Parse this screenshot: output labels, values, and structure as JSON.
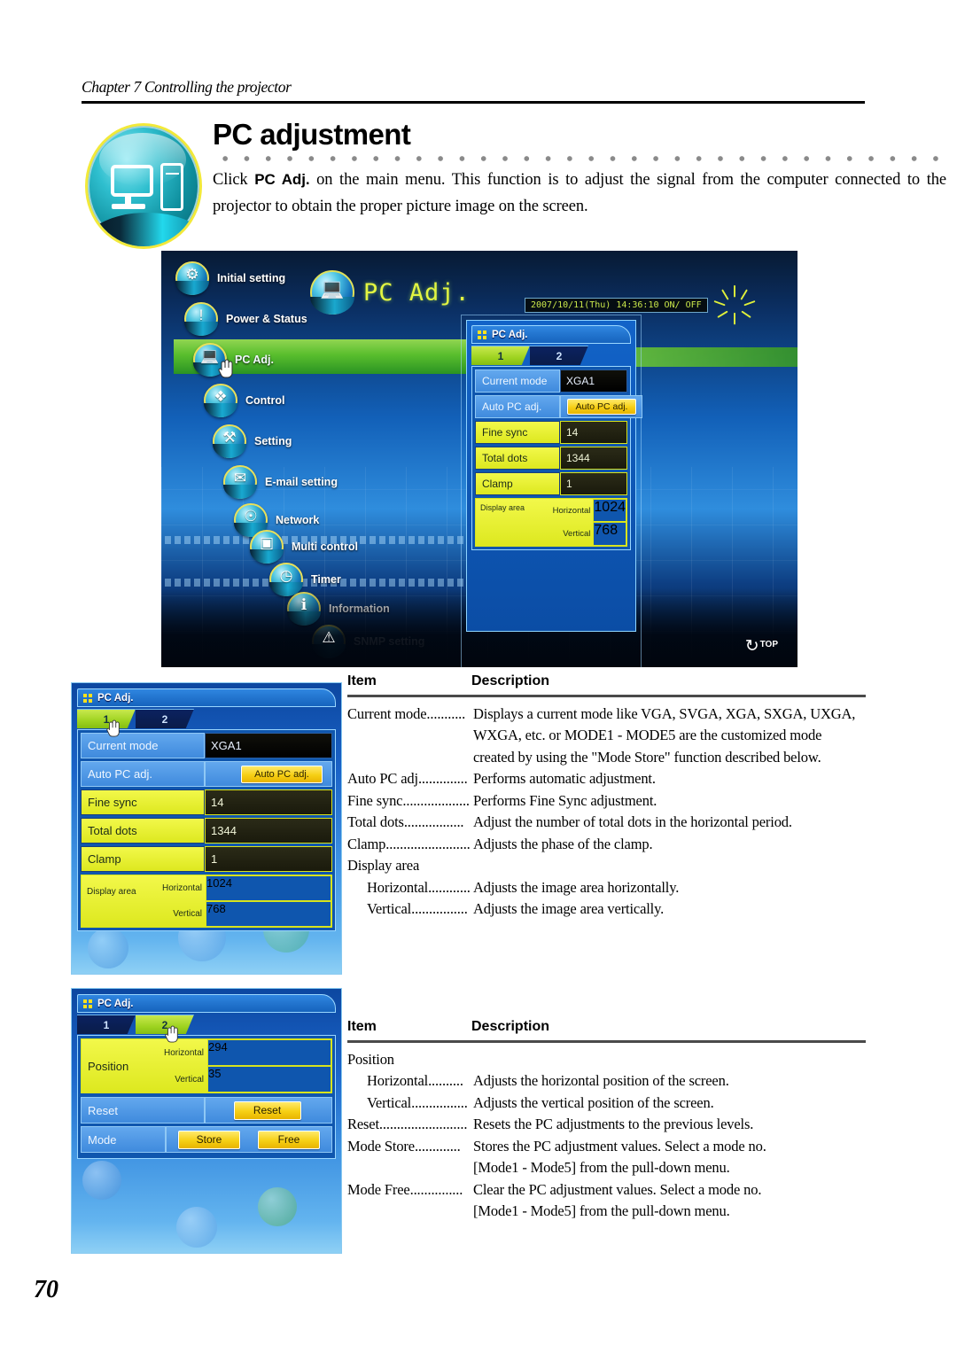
{
  "header": {
    "chapter": "Chapter 7 Controlling the projector"
  },
  "title": {
    "heading": "PC adjustment",
    "intro_prefix": "Click ",
    "intro_bold": "PC Adj.",
    "intro_rest": " on the main menu. This function is to adjust the signal from the computer connected to the projector to obtain the proper picture image on the screen."
  },
  "screenshot": {
    "banner_label": "PC Adj.",
    "datetime": "2007/10/11(Thu)  14:36:10  ON/ OFF",
    "top_button": "TOP",
    "menu_items": [
      {
        "label": "Initial setting",
        "icon": "gear-projector-icon"
      },
      {
        "label": "Power & Status",
        "icon": "power-status-icon"
      },
      {
        "label": "PC Adj.",
        "icon": "monitor-tower-icon"
      },
      {
        "label": "Control",
        "icon": "dpad-icon"
      },
      {
        "label": "Setting",
        "icon": "tools-icon"
      },
      {
        "label": "E-mail setting",
        "icon": "envelope-icon"
      },
      {
        "label": "Network",
        "icon": "network-icon"
      },
      {
        "label": "Multi control",
        "icon": "multi-control-icon"
      },
      {
        "label": "Timer",
        "icon": "clock-icon"
      },
      {
        "label": "Information",
        "icon": "info-icon"
      },
      {
        "label": "SNMP setting",
        "icon": "snmp-icon"
      }
    ]
  },
  "dialog_tab1": {
    "title": "PC Adj.",
    "tabs": [
      {
        "label": "1",
        "active": true
      },
      {
        "label": "2",
        "active": false
      }
    ],
    "rows": [
      {
        "label": "Current mode",
        "value": "XGA1",
        "style": "blue-plain"
      },
      {
        "label": "Auto PC adj.",
        "button": "Auto PC adj.",
        "style": "blue-button"
      },
      {
        "label": "Fine sync",
        "value": "14",
        "style": "yellow"
      },
      {
        "label": "Total dots",
        "value": "1344",
        "style": "yellow"
      },
      {
        "label": "Clamp",
        "value": "1",
        "style": "yellow"
      }
    ],
    "display_area": {
      "group_label": "Display area",
      "horizontal_label": "Horizontal",
      "horizontal_value": "1024",
      "vertical_label": "Vertical",
      "vertical_value": "768"
    }
  },
  "dialog_tab2": {
    "title": "PC Adj.",
    "tabs": [
      {
        "label": "1",
        "active": false
      },
      {
        "label": "2",
        "active": true
      }
    ],
    "position": {
      "group_label": "Position",
      "horizontal_label": "Horizontal",
      "horizontal_value": "294",
      "vertical_label": "Vertical",
      "vertical_value": "35"
    },
    "reset_row": {
      "label": "Reset",
      "button": "Reset"
    },
    "mode_row": {
      "label": "Mode",
      "button_store": "Store",
      "button_free": "Free"
    }
  },
  "table1": {
    "head_item": "Item",
    "head_description": "Description",
    "rows": [
      {
        "item": "Current mode",
        "dots": "...........",
        "desc": "Displays a current mode like VGA, SVGA, XGA, SXGA, UXGA,",
        "indent": false
      },
      {
        "item": "",
        "dots": "",
        "desc": "WXGA, etc. or MODE1 - MODE5 are the customized mode",
        "cont": true
      },
      {
        "item": "",
        "dots": "",
        "desc": "created by using the \"Mode Store\" function described below.",
        "cont": true
      },
      {
        "item": "Auto PC adj.",
        "dots": ".............",
        "desc": "Performs automatic adjustment.",
        "indent": false
      },
      {
        "item": "Fine sync.",
        "dots": "..................",
        "desc": "Performs Fine Sync adjustment.",
        "indent": false
      },
      {
        "item": "Total dots",
        "dots": ".................",
        "desc": "Adjust the number of total dots in the horizontal period.",
        "indent": false
      },
      {
        "item": "Clamp",
        "dots": "........................",
        "desc": "Adjusts the phase of the clamp.",
        "indent": false
      },
      {
        "item": "Display area",
        "dots": "",
        "desc": "",
        "indent": false
      },
      {
        "item": "Horizontal",
        "dots": "............",
        "desc": "Adjusts the image area horizontally.",
        "indent": true
      },
      {
        "item": "Vertical",
        "dots": "................",
        "desc": "Adjusts the image area vertically.",
        "indent": true
      }
    ]
  },
  "table2": {
    "head_item": "Item",
    "head_description": "Description",
    "rows": [
      {
        "item": "Position",
        "dots": "",
        "desc": "",
        "indent": false
      },
      {
        "item": "Horizontal",
        "dots": "..........",
        "desc": "Adjusts the horizontal position of the screen.",
        "indent": true
      },
      {
        "item": "Vertical",
        "dots": "................",
        "desc": "Adjusts the vertical position of the screen.",
        "indent": true
      },
      {
        "item": "Reset",
        "dots": ".........................",
        "desc": "Resets the PC adjustments to the previous levels.",
        "indent": false
      },
      {
        "item": "Mode Store",
        "dots": ".............",
        "desc": "Stores the PC adjustment values. Select a mode no.",
        "indent": false
      },
      {
        "item": "",
        "dots": "",
        "desc": "[Mode1 - Mode5] from the pull-down menu.",
        "cont": true
      },
      {
        "item": "Mode Free",
        "dots": "...............",
        "desc": "Clear the PC adjustment values. Select a mode no.",
        "indent": false
      },
      {
        "item": "",
        "dots": "",
        "desc": "[Mode1 - Mode5]  from the pull-down menu.",
        "cont": true
      }
    ]
  },
  "footer": {
    "page_number": "70"
  },
  "colors": {
    "accent_yellow": "#e8f020",
    "accent_green": "#9ed320",
    "dialog_blue": "#0f56ae",
    "highlight_green": "#66d31d"
  }
}
